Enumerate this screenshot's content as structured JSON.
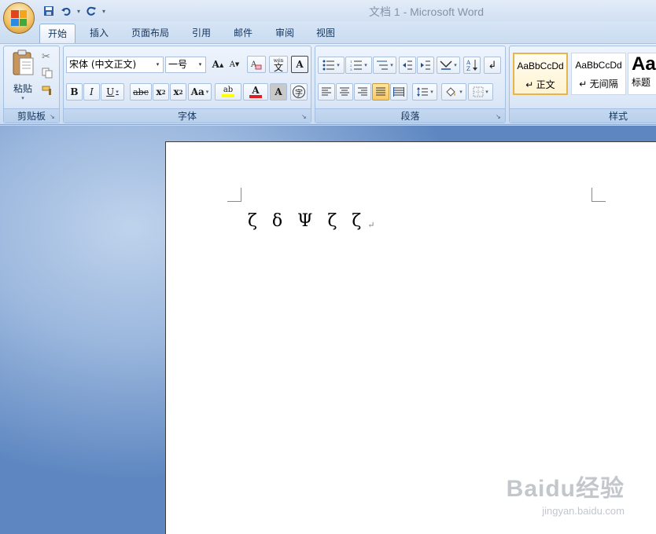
{
  "window": {
    "title": "文档 1 - Microsoft Word"
  },
  "office_button": {
    "icon": "office-logo-icon"
  },
  "quick_access": {
    "save_icon": "save-icon",
    "undo_icon": "undo-icon",
    "redo_icon": "redo-icon",
    "customize_icon": "customize-qat-icon"
  },
  "tabs": [
    {
      "label": "开始",
      "active": true
    },
    {
      "label": "插入"
    },
    {
      "label": "页面布局"
    },
    {
      "label": "引用"
    },
    {
      "label": "邮件"
    },
    {
      "label": "审阅"
    },
    {
      "label": "视图"
    }
  ],
  "clipboard": {
    "group_label": "剪贴板",
    "paste_label": "粘贴"
  },
  "font": {
    "group_label": "字体",
    "font_name": "宋体 (中文正文)",
    "font_size": "一号",
    "grow_label": "A",
    "shrink_label": "A",
    "clear_format_label": "A",
    "phonetic_label": "文",
    "phonetic_top": "wén",
    "border_char_label": "A",
    "bold": "B",
    "italic": "I",
    "underline": "U",
    "strike": "abc",
    "subscript": "x",
    "superscript": "x",
    "case": "Aa",
    "highlight": "ab",
    "font_color": "A",
    "char_shade": "A",
    "enclose": "字"
  },
  "paragraph": {
    "group_label": "段落"
  },
  "styles": {
    "group_label": "样式",
    "items": [
      {
        "sample": "AaBbCcDd",
        "name": "↵ 正文"
      },
      {
        "sample": "AaBbCcDd",
        "name": "↵ 无间隔"
      },
      {
        "sample": "Aa",
        "name": "标题"
      }
    ]
  },
  "document": {
    "text": "ζ δ Ψ ζ ζ",
    "para_mark": "↵"
  },
  "watermark": {
    "logo": "Baidu经验",
    "url": "jingyan.baidu.com"
  },
  "colors": {
    "accent": "#f9c864",
    "font_color_bar": "#e02020",
    "highlight_bar": "#ffff00"
  }
}
